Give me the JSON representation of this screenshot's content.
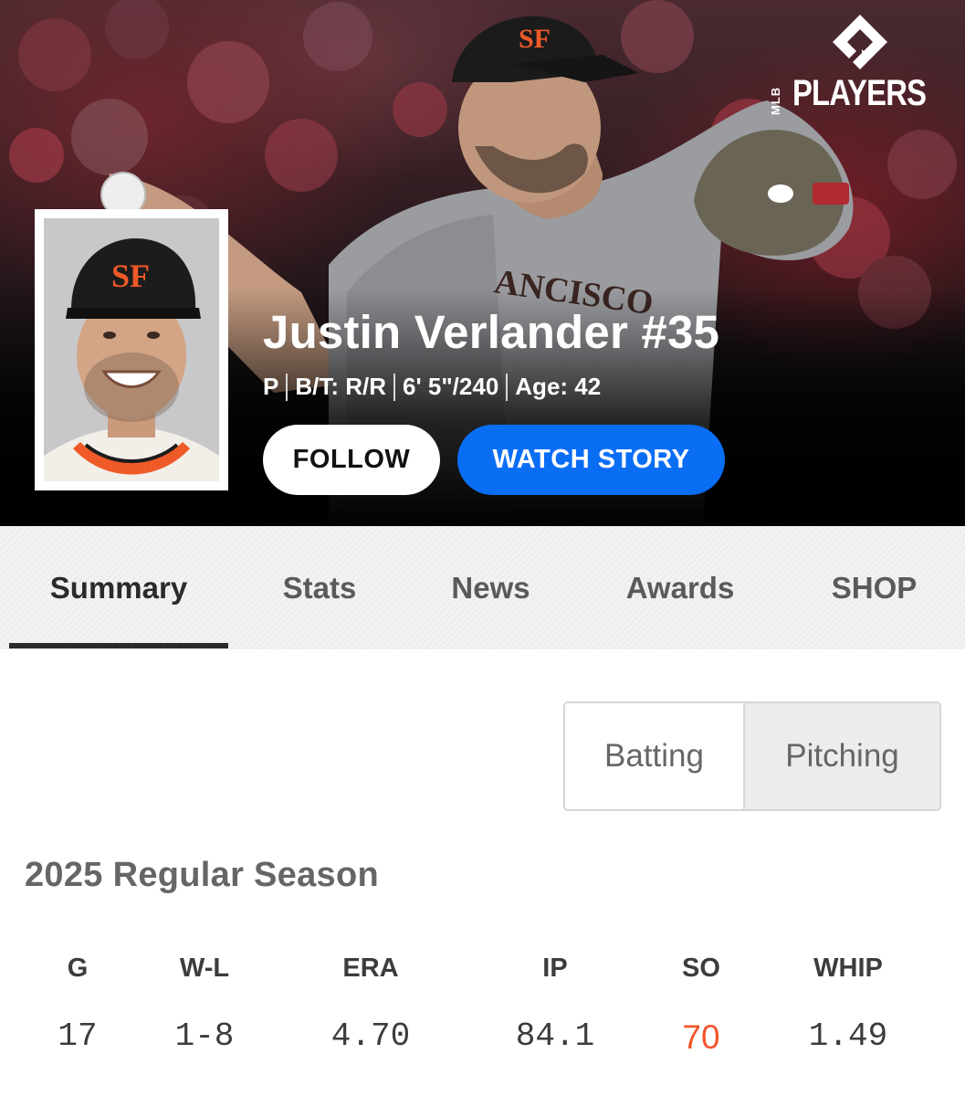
{
  "player": {
    "name_line": "Justin Verlander #35",
    "position": "P",
    "bats_throws": "B/T: R/R",
    "height_weight": "6' 5\"/240",
    "age": "Age: 42"
  },
  "hero": {
    "logo_text": "PLAYERS",
    "logo_small": "MLB"
  },
  "actions": {
    "follow_label": "FOLLOW",
    "watch_label": "WATCH STORY"
  },
  "tabs": [
    {
      "label": "Summary",
      "active": true
    },
    {
      "label": "Stats",
      "active": false
    },
    {
      "label": "News",
      "active": false
    },
    {
      "label": "Awards",
      "active": false
    },
    {
      "label": "SHOP",
      "active": false
    }
  ],
  "stat_toggle": {
    "batting_label": "Batting",
    "pitching_label": "Pitching",
    "selected": "Pitching"
  },
  "season": {
    "title": "2025 Regular Season",
    "columns": [
      "G",
      "W-L",
      "ERA",
      "IP",
      "SO",
      "WHIP"
    ],
    "values": [
      "17",
      "1-8",
      "4.70",
      "84.1",
      "70",
      "1.49"
    ],
    "highlight_column": "SO"
  },
  "colors": {
    "accent_blue": "#0a6ef5",
    "highlight_orange": "#f2552c",
    "giants_orange": "#f05a28"
  }
}
